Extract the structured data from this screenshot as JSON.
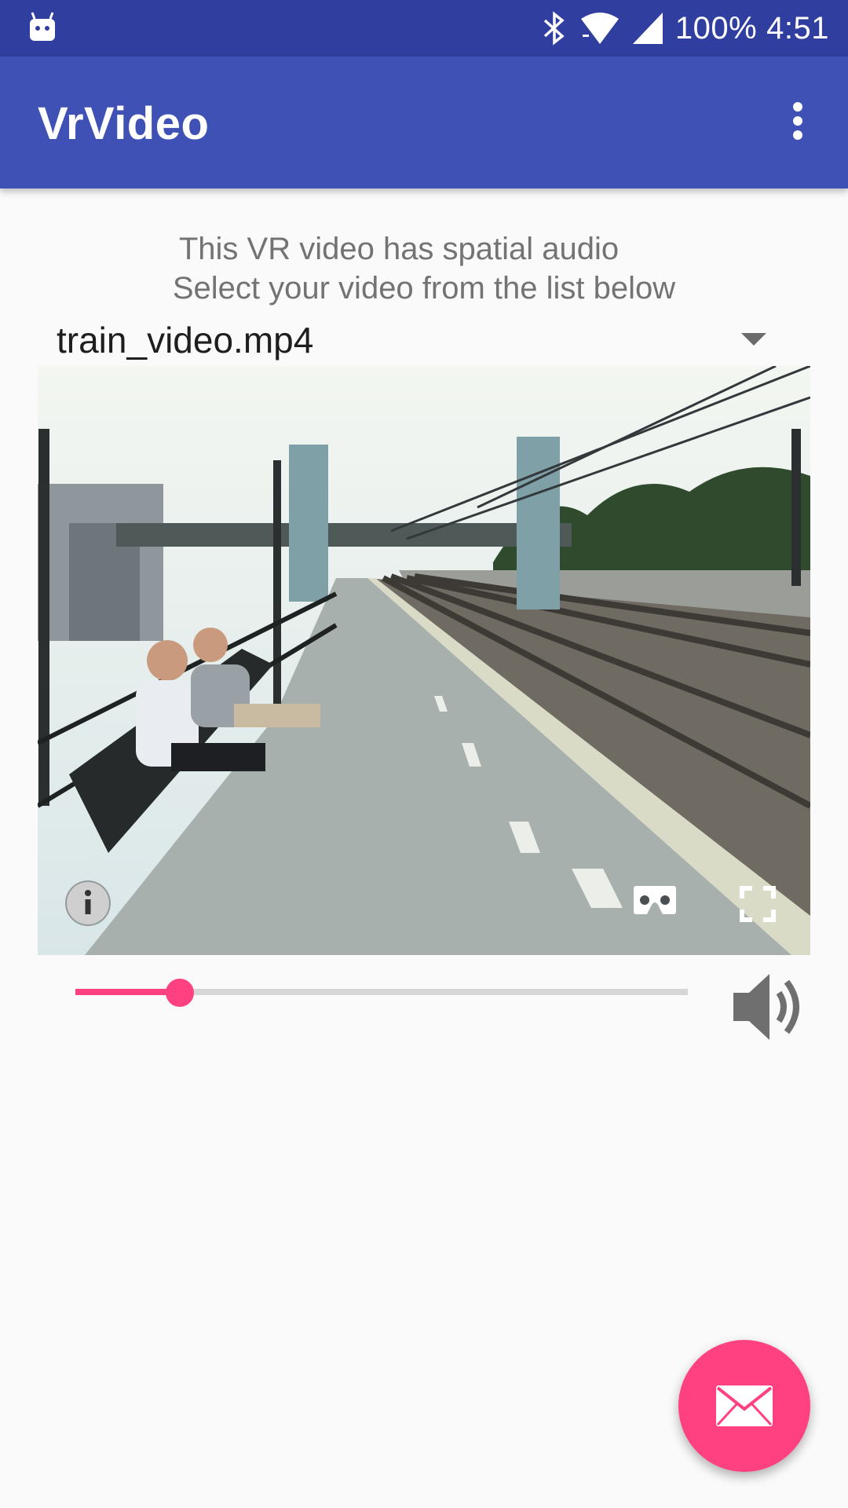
{
  "status_bar": {
    "battery": "100%",
    "time": "4:51"
  },
  "app_bar": {
    "title": "VrVideo",
    "menu_icon": "more-vert-icon"
  },
  "intro": {
    "line1": "This VR video has spatial audio",
    "line2": "Select your video from the list below"
  },
  "video_selector": {
    "selected": "train_video.mp4"
  },
  "video_player": {
    "info_icon": "info-icon",
    "cardboard_icon": "cardboard-icon",
    "fullscreen_icon": "fullscreen-icon"
  },
  "seekbar": {
    "progress_fraction": 0.17
  },
  "volume": {
    "icon": "volume-up-icon"
  },
  "fab": {
    "icon": "mail-icon"
  },
  "colors": {
    "status_bar": "#303f9f",
    "app_bar": "#3f51b5",
    "accent": "#ff4081"
  }
}
